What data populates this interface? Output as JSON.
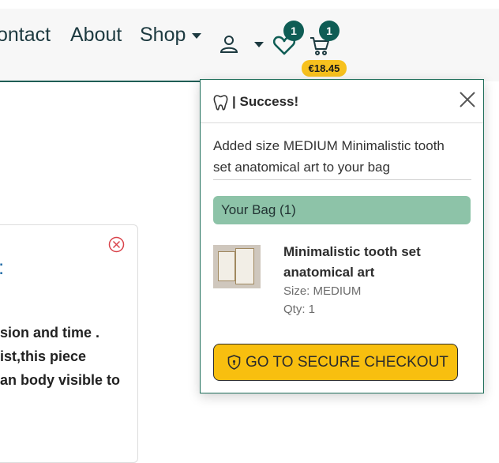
{
  "nav": {
    "contact": "ontact",
    "about": "About",
    "shop": "Shop"
  },
  "header": {
    "wishlist_count": "1",
    "cart_count": "1",
    "cart_total": "€18.45"
  },
  "background_card": {
    "fragment": ":",
    "lines": [
      "sion and time .",
      "ist,this piece",
      "an body visible to"
    ]
  },
  "popover": {
    "title": "| Success!",
    "message": "Added size MEDIUM Minimalistic tooth set anatomical art to your bag",
    "bag_label": "Your Bag (1)",
    "item": {
      "name": "Minimalistic tooth set anatomical art",
      "size": "Size: MEDIUM",
      "qty": "Qty: 1"
    },
    "checkout_label": "GO TO SECURE CHECKOUT"
  },
  "colors": {
    "brand_green": "#0f5d55",
    "bag_bar": "#8dc3a8",
    "checkout_yellow": "#f8bf0f",
    "price_yellow": "#f7c11e",
    "close_red": "#d9434b"
  },
  "icons": [
    "user-icon",
    "heart-icon",
    "cart-icon",
    "tooth-icon",
    "close-icon",
    "shield-icon",
    "circle-x-icon"
  ]
}
